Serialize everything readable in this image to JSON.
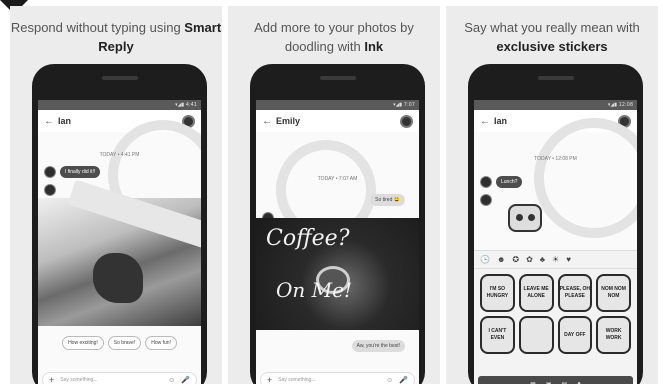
{
  "panels": [
    {
      "caption_pre": "Respond without typing using ",
      "caption_bold": "Smart Reply",
      "contact": "Ian",
      "timestamp": "TODAY • 4:41 PM",
      "incoming": "I finally did it!!",
      "suggestions": [
        "How exciting!",
        "So brave!",
        "How fun!"
      ],
      "composer_placeholder": "Say something..."
    },
    {
      "caption_pre": "Add more to your photos by doodling with ",
      "caption_bold": "Ink",
      "contact": "Emily",
      "timestamp": "TODAY • 7:07 AM",
      "outgoing_1": "So tired 😩",
      "ink_line1": "Coffee?",
      "ink_line2": "On Me!",
      "outgoing_2": "Aw, you're the best!",
      "composer_placeholder": "Say something..."
    },
    {
      "caption_pre": "Say what you really mean with ",
      "caption_bold": "exclusive stickers",
      "contact": "Ian",
      "timestamp": "TODAY • 12:08 PM",
      "incoming": "Lunch?",
      "stickers": [
        "I'M SO HUNGRY",
        "LEAVE ME ALONE",
        "PLEASE, OH PLEASE",
        "NOM NOM NOM",
        "I CAN'T EVEN",
        "",
        "DAY OFF",
        "WORK WORK"
      ]
    }
  ]
}
